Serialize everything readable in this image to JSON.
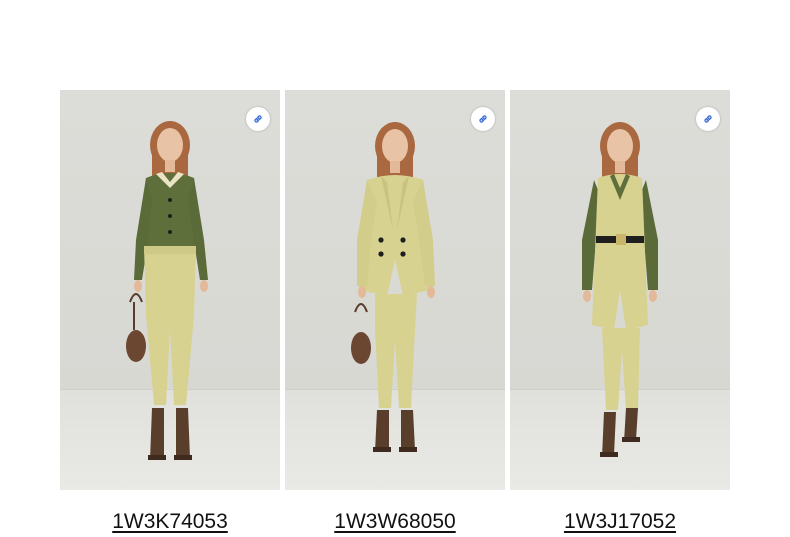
{
  "products": [
    {
      "code": "1W3K74053",
      "link_icon": "link-icon"
    },
    {
      "code": "1W3W68050",
      "link_icon": "link-icon"
    },
    {
      "code": "1W3J17052",
      "link_icon": "link-icon"
    }
  ],
  "colors": {
    "background": "#ffffff",
    "photo_backdrop": "#d8d8d3",
    "blouse_green": "#5f6f3c",
    "suit_yellow": "#d8d291",
    "boots_brown": "#5a3e2c",
    "link_icon": "#3e6fd8"
  }
}
